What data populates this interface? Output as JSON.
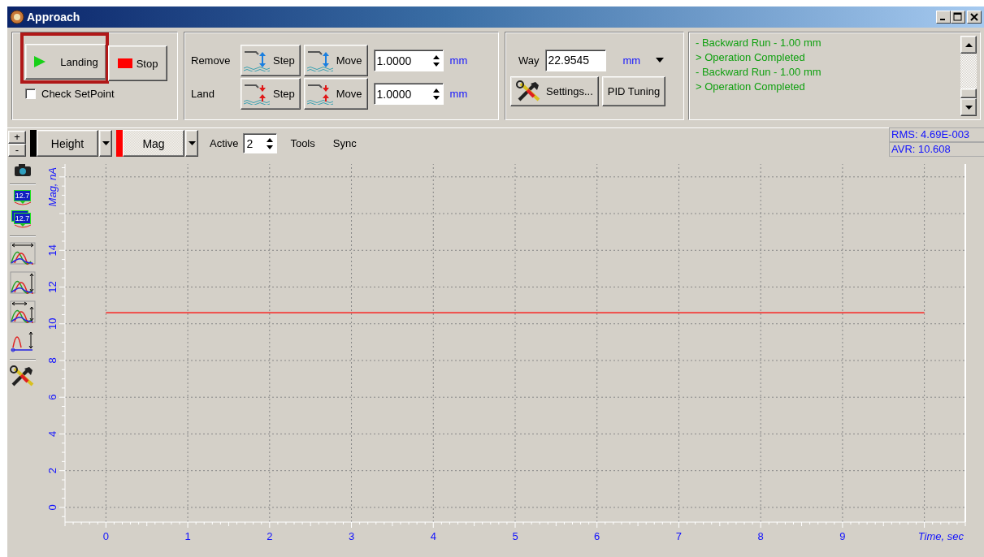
{
  "window": {
    "title": "Approach"
  },
  "landing_panel": {
    "buttons": [
      {
        "label": "Landing",
        "kind": "start",
        "highlighted": true
      },
      {
        "label": "Stop",
        "kind": "stop",
        "highlighted": false
      }
    ],
    "check_setpoint": {
      "label": "Check SetPoint",
      "checked": false
    }
  },
  "motion_panel": {
    "rows": [
      {
        "label": "Remove",
        "kind": "remove",
        "buttons": [
          "Step",
          "Move"
        ],
        "value": "1.0000",
        "unit": "mm"
      },
      {
        "label": "Land",
        "kind": "land",
        "buttons": [
          "Step",
          "Move"
        ],
        "value": "1.0000",
        "unit": "mm"
      }
    ]
  },
  "way_panel": {
    "label": "Way",
    "value": "22.9545",
    "unit": "mm",
    "buttons": [
      {
        "label": "Settings...",
        "kind": "settings"
      },
      {
        "label": "PID Tuning",
        "kind": "plain"
      }
    ]
  },
  "log": [
    "- Backward Run - 1.00 mm",
    "> Operation Completed",
    "- Backward Run - 1.00 mm",
    "> Operation Completed"
  ],
  "chart_toolbar": {
    "zoom_buttons": [
      "+",
      "-"
    ],
    "channels": [
      {
        "label": "Height",
        "color": "#000000",
        "selected": false
      },
      {
        "label": "Mag",
        "color": "#ff0000",
        "selected": true
      }
    ],
    "active_label": "Active",
    "active_value": "2",
    "menus": [
      "Tools",
      "Sync"
    ],
    "stats": [
      "RMS: 4.69E-003",
      "AVR: 10.608"
    ]
  },
  "side_tools": [
    {
      "kind": "camera"
    },
    {
      "kind": "readout",
      "label": "12.7"
    },
    {
      "kind": "readout_stack",
      "label": "12.7"
    },
    {
      "kind": "fit_x"
    },
    {
      "kind": "fit_y"
    },
    {
      "kind": "fit_xy"
    },
    {
      "kind": "fit_peak"
    },
    {
      "kind": "tools"
    }
  ],
  "chart": {
    "chart_data": {
      "type": "line",
      "xlabel": "Time, sec",
      "ylabel": "Mag, nA",
      "x": [
        0,
        10
      ],
      "series": [
        {
          "color": "#ff0000",
          "values": [
            10.6,
            10.6
          ]
        }
      ],
      "grid": true,
      "xlim": [
        -0.5,
        10.5
      ],
      "ylim": [
        -0.8,
        18.7
      ],
      "xticks": [
        0,
        1,
        2,
        3,
        4,
        5,
        6,
        7,
        8,
        9
      ],
      "yticks": [
        0,
        2,
        4,
        6,
        8,
        10,
        12,
        14
      ]
    }
  }
}
